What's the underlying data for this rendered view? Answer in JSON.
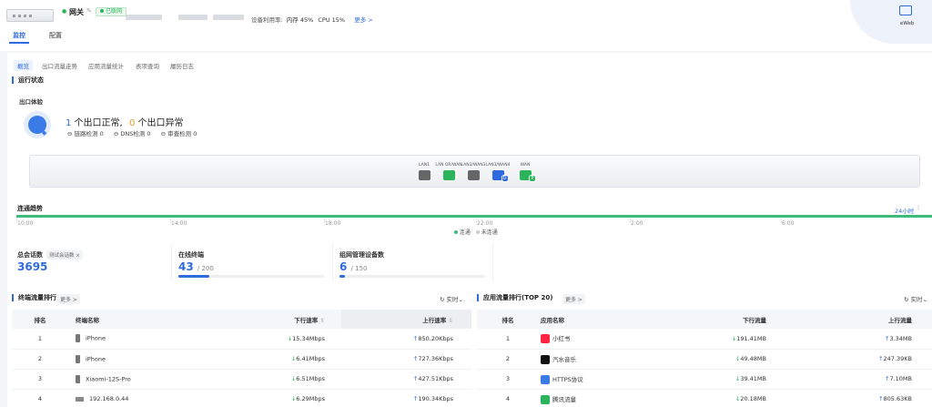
{
  "header": {
    "device_name": "网关",
    "status": "已联网",
    "util_label": "设备利用率:",
    "memory": "内存 45%",
    "cpu": "CPU 15%",
    "more": "更多 >",
    "eweb": "eWeb"
  },
  "tabs": [
    "监控",
    "配置"
  ],
  "subtabs": [
    "概览",
    "出口流量走势",
    "应用流量统计",
    "表项查询",
    "履历日志"
  ],
  "run_status": {
    "title": "运行状态",
    "exit_title": "出口体验",
    "normal_count": "1",
    "normal_text": "个出口正常,",
    "abnormal_count": "0",
    "abnormal_text": "个出口异常",
    "checks": [
      "链路检测 0",
      "DNS检测 0",
      "审查检测 0"
    ]
  },
  "ports": [
    {
      "label": "LAN1",
      "color": "#666666",
      "badge": ""
    },
    {
      "label": "LAN OR/WAN",
      "color": "#2bb45a",
      "badge": ""
    },
    {
      "label": "LAN3/WAN3",
      "color": "#666666",
      "badge": ""
    },
    {
      "label": "LAN3/WAN4",
      "color": "#2f6bde",
      "badge": "D"
    },
    {
      "label": "WAN",
      "color": "#2bb45a",
      "badge": "P"
    }
  ],
  "trend": {
    "title": "连通趋势",
    "range": "24小时",
    "ticks": [
      "10:00",
      "14:00",
      "18:00",
      "22:00",
      "2:00",
      "6:00"
    ],
    "legend_ok": "连通",
    "legend_no": "未连通"
  },
  "stats": {
    "sessions_label": "总会话数",
    "sessions_tag": "测试会话数 ×",
    "sessions_value": "3695",
    "terminals_label": "在线终端",
    "terminals_value": "43",
    "terminals_total": "/ 200",
    "terminals_fraction": 0.215,
    "managed_label": "组网管理设备数",
    "managed_value": "6",
    "managed_total": "/ 150",
    "managed_fraction": 0.04
  },
  "terminal_rank": {
    "title": "终端流量排行",
    "more": "更多 >",
    "realtime": "实时",
    "headers": [
      "排名",
      "终端名称",
      "下行速率",
      "上行速率"
    ],
    "rows": [
      {
        "rank": "1",
        "name": "iPhone",
        "type": "phone",
        "down": "15.34Mbps",
        "up": "850.20Kbps"
      },
      {
        "rank": "2",
        "name": "iPhone",
        "type": "phone",
        "down": "6.41Mbps",
        "up": "727.36Kbps"
      },
      {
        "rank": "3",
        "name": "Xiaomi-12S-Pro",
        "type": "phone",
        "down": "6.51Mbps",
        "up": "427.51Kbps"
      },
      {
        "rank": "4",
        "name": "192.168.0.44",
        "type": "pc",
        "down": "6.29Mbps",
        "up": "190.34Kbps"
      }
    ]
  },
  "app_rank": {
    "title": "应用流量排行(TOP 20)",
    "more": "更多 >",
    "realtime": "实时",
    "headers": [
      "排名",
      "应用名称",
      "下行流量",
      "上行流量"
    ],
    "rows": [
      {
        "rank": "1",
        "name": "小红书",
        "icon_color": "#ff2442",
        "down": "191.41MB",
        "up": "3.34MB"
      },
      {
        "rank": "2",
        "name": "汽水音乐",
        "icon_color": "#111111",
        "down": "49.48MB",
        "up": "247.39KB"
      },
      {
        "rank": "3",
        "name": "HTTPS协议",
        "icon_color": "#3a7be8",
        "down": "39.41MB",
        "up": "7.10MB"
      },
      {
        "rank": "4",
        "name": "腾讯流量",
        "icon_color": "#2bb45a",
        "down": "20.18MB",
        "up": "805.63KB"
      }
    ]
  }
}
